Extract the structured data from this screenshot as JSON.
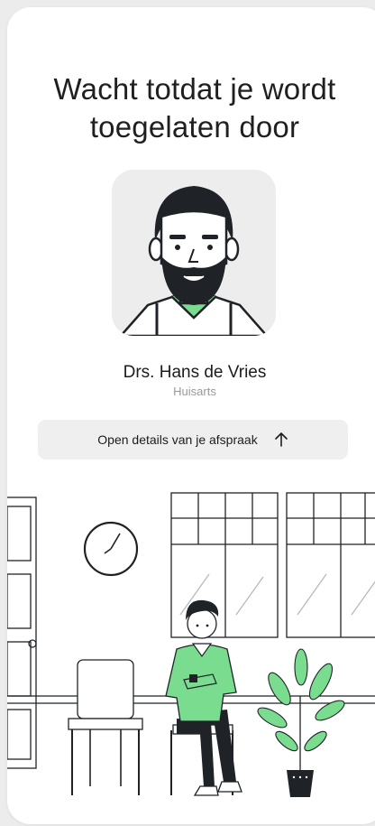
{
  "screen": {
    "title": "Wacht totdat je wordt toegelaten door"
  },
  "doctor": {
    "name": "Drs. Hans de Vries",
    "role": "Huisarts",
    "avatar_icon": "doctor-avatar-illustration"
  },
  "details_button": {
    "label": "Open details van je afspraak",
    "icon": "arrow-up-icon"
  },
  "illustration": {
    "name": "waiting-room-illustration",
    "accent_color": "#79dc8f",
    "line_color": "#1f2328"
  }
}
